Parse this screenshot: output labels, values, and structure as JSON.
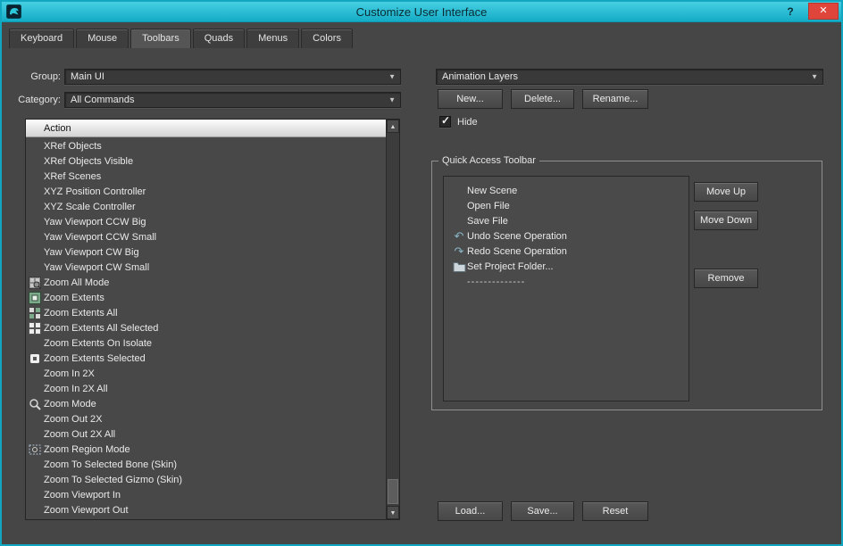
{
  "window": {
    "title": "Customize User Interface",
    "help": "?",
    "close": "✕"
  },
  "colors": {
    "titlebar_teal": "#18b4cf",
    "close_red": "#e0453c",
    "dialog_gray": "#464646",
    "icon_accent_teal": "#8ab8ca"
  },
  "tabs": [
    {
      "label": "Keyboard",
      "active": false
    },
    {
      "label": "Mouse",
      "active": false
    },
    {
      "label": "Toolbars",
      "active": true
    },
    {
      "label": "Quads",
      "active": false
    },
    {
      "label": "Menus",
      "active": false
    },
    {
      "label": "Colors",
      "active": false
    }
  ],
  "left": {
    "group_label": "Group:",
    "group_value": "Main UI",
    "category_label": "Category:",
    "category_value": "All Commands",
    "action_header": "Action",
    "actions": [
      {
        "label": "XRef Objects",
        "icon": ""
      },
      {
        "label": "XRef Objects Visible",
        "icon": ""
      },
      {
        "label": "XRef Scenes",
        "icon": ""
      },
      {
        "label": "XYZ Position Controller",
        "icon": ""
      },
      {
        "label": "XYZ Scale Controller",
        "icon": ""
      },
      {
        "label": "Yaw Viewport CCW Big",
        "icon": ""
      },
      {
        "label": "Yaw Viewport CCW Small",
        "icon": ""
      },
      {
        "label": "Yaw Viewport CW Big",
        "icon": ""
      },
      {
        "label": "Yaw Viewport CW Small",
        "icon": ""
      },
      {
        "label": "Zoom All Mode",
        "icon": "zoom-all-mode"
      },
      {
        "label": "Zoom Extents",
        "icon": "zoom-extents"
      },
      {
        "label": "Zoom Extents All",
        "icon": "zoom-extents-all"
      },
      {
        "label": "Zoom Extents All Selected",
        "icon": "zoom-extents-all-selected"
      },
      {
        "label": "Zoom Extents On Isolate",
        "icon": ""
      },
      {
        "label": "Zoom Extents Selected",
        "icon": "zoom-extents-selected"
      },
      {
        "label": "Zoom In 2X",
        "icon": ""
      },
      {
        "label": "Zoom In 2X All",
        "icon": ""
      },
      {
        "label": "Zoom Mode",
        "icon": "zoom-mode"
      },
      {
        "label": "Zoom Out 2X",
        "icon": ""
      },
      {
        "label": "Zoom Out 2X All",
        "icon": ""
      },
      {
        "label": "Zoom Region Mode",
        "icon": "zoom-region-mode"
      },
      {
        "label": "Zoom To Selected Bone (Skin)",
        "icon": ""
      },
      {
        "label": "Zoom To Selected Gizmo (Skin)",
        "icon": ""
      },
      {
        "label": "Zoom Viewport In",
        "icon": ""
      },
      {
        "label": "Zoom Viewport Out",
        "icon": ""
      }
    ]
  },
  "right": {
    "toolbar_value": "Animation Layers",
    "buttons": {
      "new": "New...",
      "delete": "Delete...",
      "rename": "Rename..."
    },
    "hide_label": "Hide",
    "hide_checked": true,
    "qat": {
      "title": "Quick Access Toolbar",
      "items": [
        {
          "label": "New Scene",
          "icon": ""
        },
        {
          "label": "Open File",
          "icon": ""
        },
        {
          "label": "Save File",
          "icon": ""
        },
        {
          "label": "Undo Scene Operation",
          "icon": "undo"
        },
        {
          "label": "Redo Scene Operation",
          "icon": "redo"
        },
        {
          "label": "Set Project Folder...",
          "icon": "folder"
        },
        {
          "label": "--------------",
          "icon": ""
        }
      ],
      "buttons": {
        "move_up": "Move Up",
        "move_down": "Move Down",
        "remove": "Remove"
      }
    },
    "bottom": {
      "load": "Load...",
      "save": "Save...",
      "reset": "Reset"
    }
  }
}
